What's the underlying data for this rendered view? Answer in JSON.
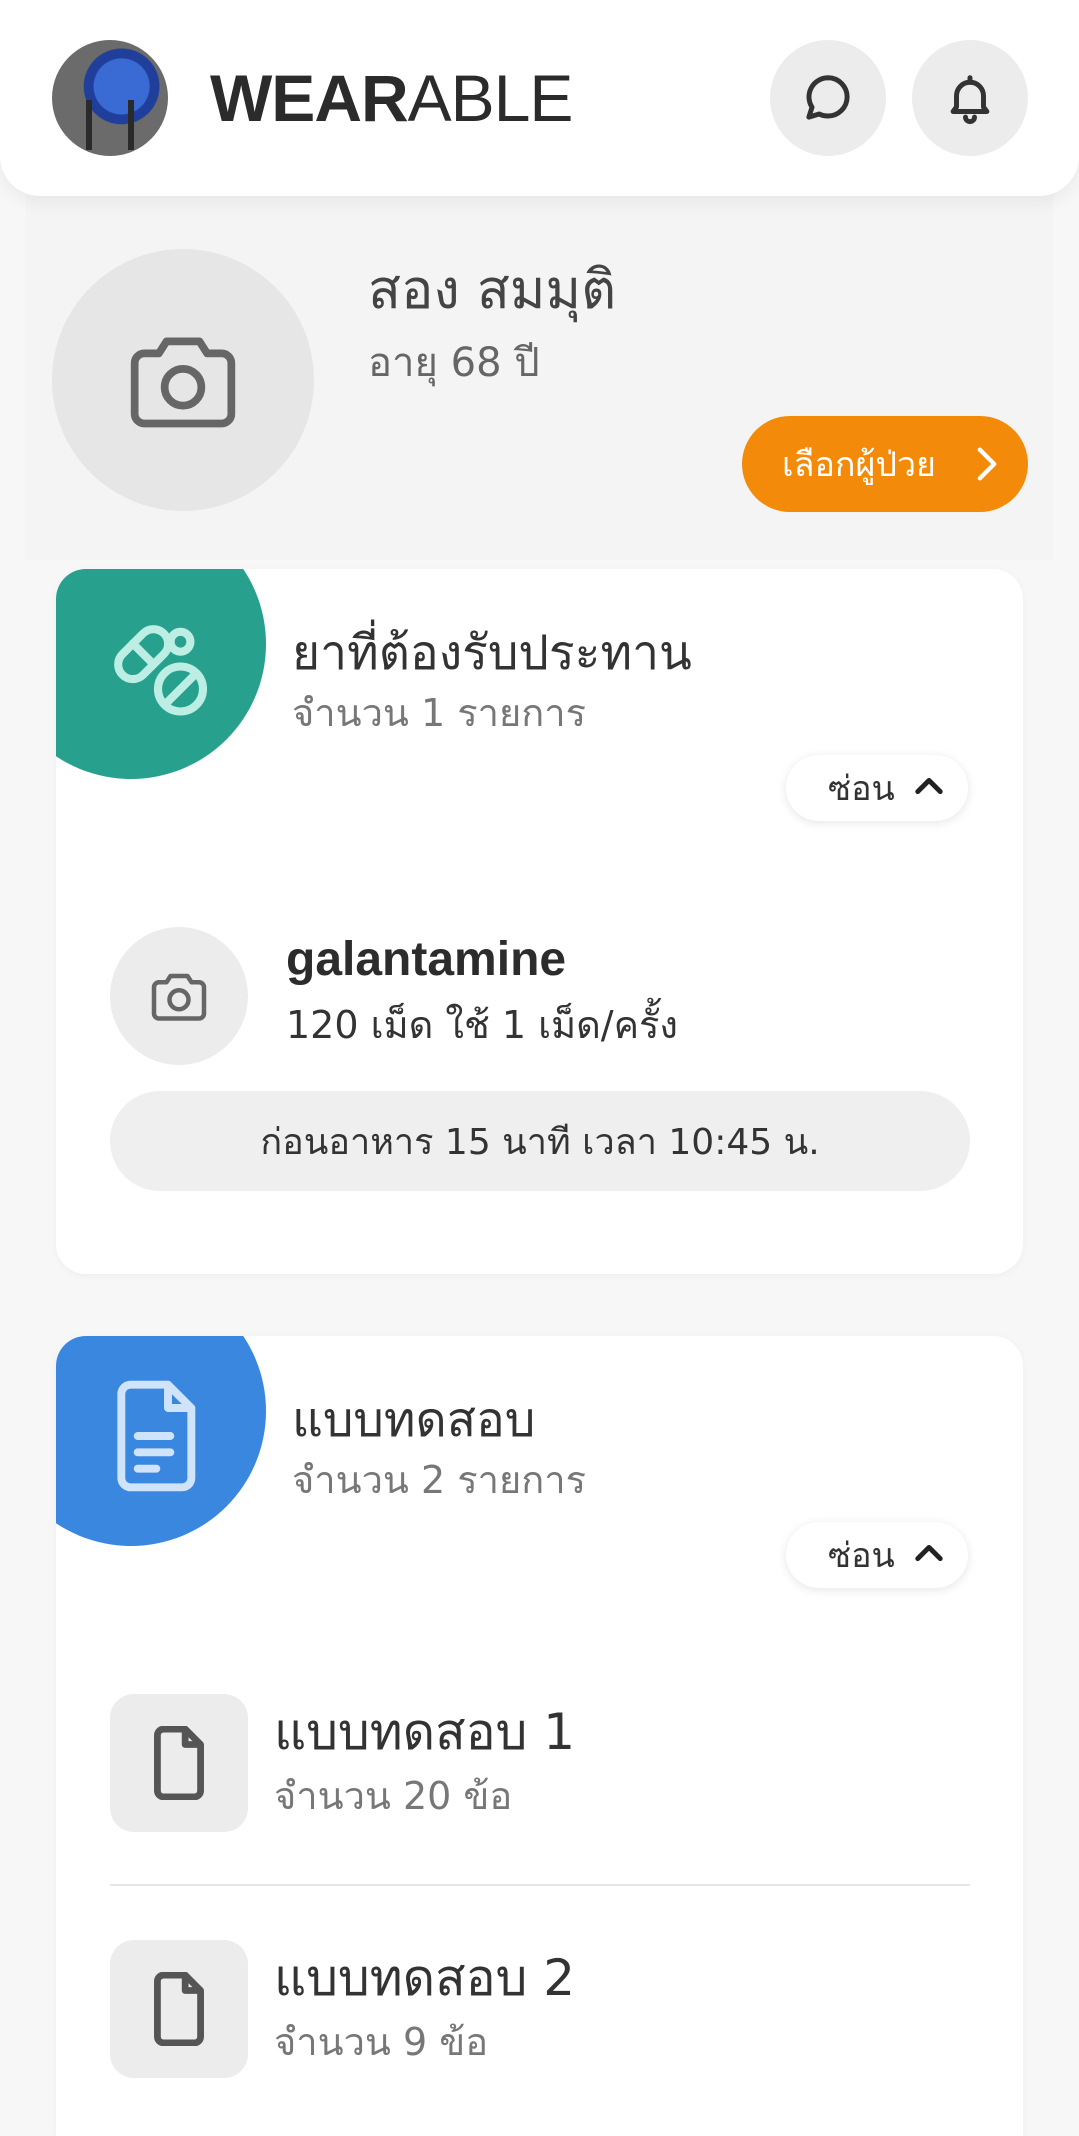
{
  "header": {
    "brand_bold": "WEAR",
    "brand_light": "ABLE"
  },
  "patient": {
    "name": "สอง สมมุติ",
    "age": "อายุ 68 ปี",
    "select_label": "เลือกผู้ป่วย"
  },
  "medicine_card": {
    "title": "ยาที่ต้องรับประทาน",
    "count": "จำนวน 1 รายการ",
    "hide_label": "ซ่อน",
    "items": [
      {
        "name": "galantamine",
        "dose": "120 เม็ด ใช้ 1 เม็ด/ครั้ง",
        "schedule": "ก่อนอาหาร 15 นาที เวลา 10:45 น."
      }
    ]
  },
  "test_card": {
    "title": "แบบทดสอบ",
    "count": "จำนวน 2 รายการ",
    "hide_label": "ซ่อน",
    "items": [
      {
        "title": "แบบทดสอบ 1",
        "count": "จำนวน 20 ข้อ"
      },
      {
        "title": "แบบทดสอบ 2",
        "count": "จำนวน 9 ข้อ"
      }
    ]
  },
  "colors": {
    "accent_orange": "#f48a0a",
    "medicine_teal": "#27a08e",
    "test_blue": "#3a87e0"
  },
  "icons": [
    "chat-bubble-icon",
    "bell-icon",
    "camera-icon",
    "pills-icon",
    "document-icon",
    "file-icon",
    "chevron-right-icon",
    "chevron-up-icon"
  ]
}
